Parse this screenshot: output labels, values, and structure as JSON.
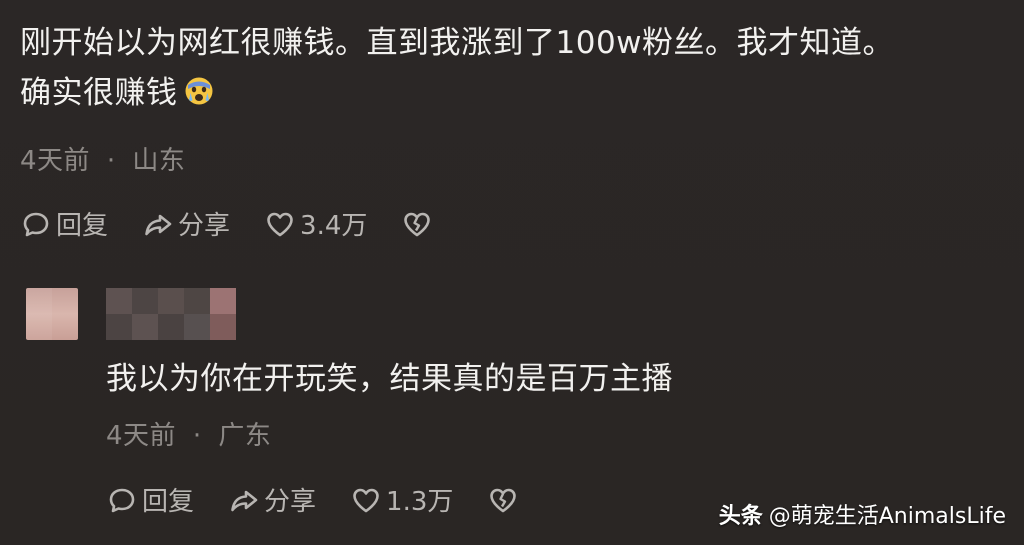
{
  "comment1": {
    "line1": "刚开始以为网红很赚钱。直到我涨到了100w粉丝。我才知道。",
    "line2": "确实很赚钱",
    "emoji": "crying-face-emoji",
    "time": "4天前",
    "location": "山东",
    "reply_label": "回复",
    "share_label": "分享",
    "likes": "3.4万"
  },
  "comment2": {
    "text": "我以为你在开玩笑，结果真的是百万主播",
    "time": "4天前",
    "location": "广东",
    "reply_label": "回复",
    "share_label": "分享",
    "likes": "1.3万"
  },
  "watermark": {
    "brand": "头条",
    "handle": "@萌宠生活AnimalsLife"
  },
  "meta_separator": "·",
  "colors": {
    "background": "#2b2726",
    "text": "#f2f1ef",
    "meta": "#8d8986",
    "action": "#b8b5b2"
  }
}
